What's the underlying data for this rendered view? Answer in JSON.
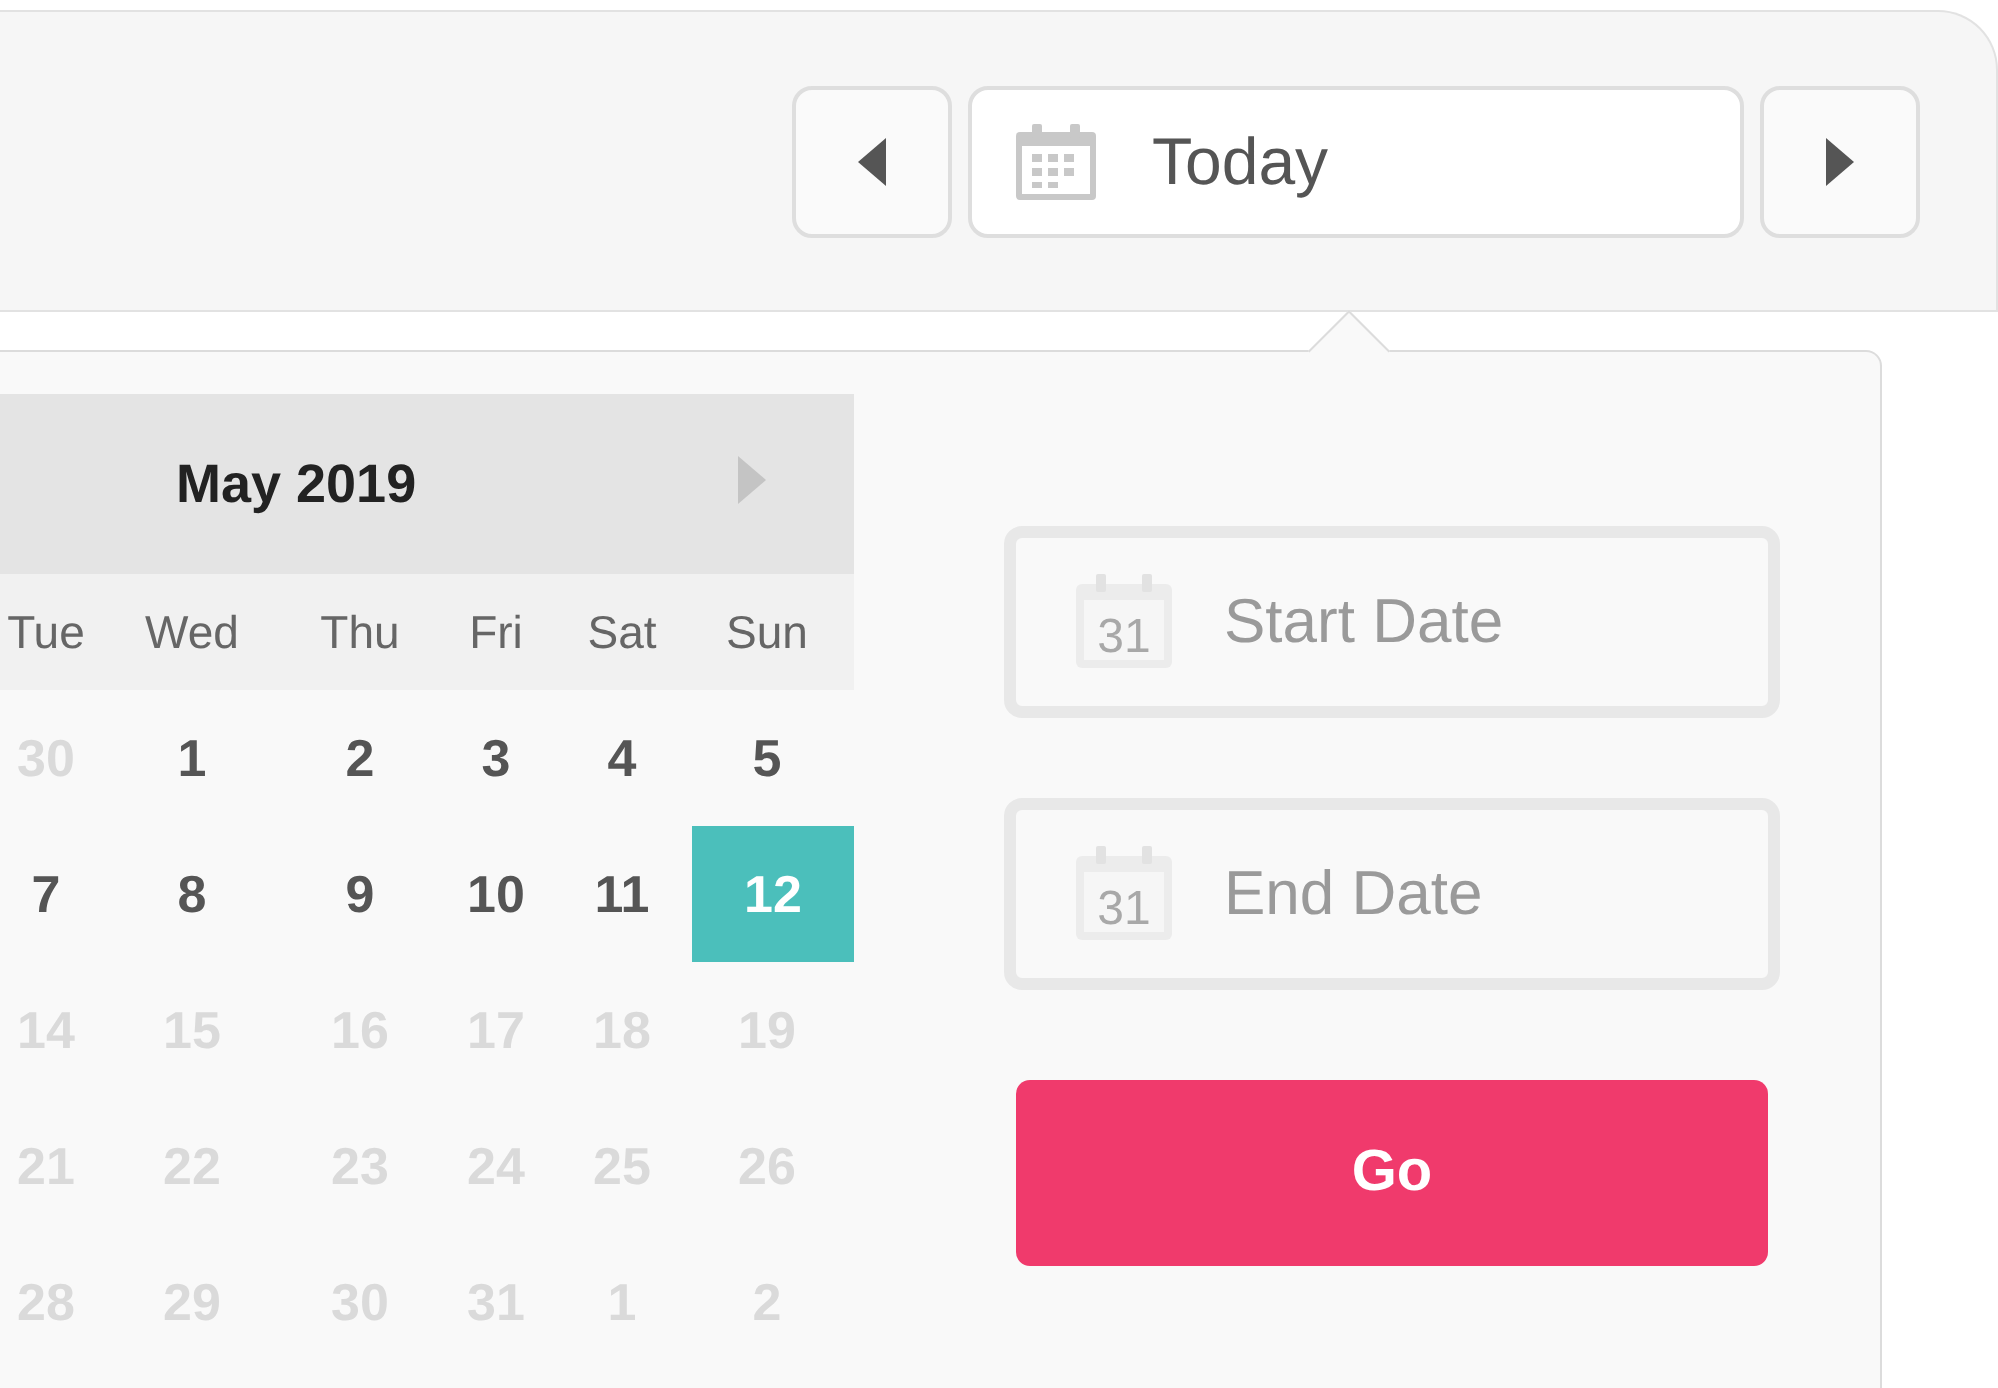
{
  "toolbar": {
    "date_button": {
      "label": "Today"
    }
  },
  "calendar": {
    "month": "May 2019",
    "weekdays": [
      "Tue",
      "Wed",
      "Thu",
      "Fri",
      "Sat",
      "Sun"
    ],
    "weeks": [
      [
        {
          "day": "30",
          "faded": true,
          "selected": false
        },
        {
          "day": "1",
          "faded": false,
          "selected": false
        },
        {
          "day": "2",
          "faded": false,
          "selected": false
        },
        {
          "day": "3",
          "faded": false,
          "selected": false
        },
        {
          "day": "4",
          "faded": false,
          "selected": false
        },
        {
          "day": "5",
          "faded": false,
          "selected": false
        }
      ],
      [
        {
          "day": "7",
          "faded": false,
          "selected": false
        },
        {
          "day": "8",
          "faded": false,
          "selected": false
        },
        {
          "day": "9",
          "faded": false,
          "selected": false
        },
        {
          "day": "10",
          "faded": false,
          "selected": false
        },
        {
          "day": "11",
          "faded": false,
          "selected": false
        },
        {
          "day": "12",
          "faded": false,
          "selected": true
        }
      ],
      [
        {
          "day": "14",
          "faded": true,
          "selected": false
        },
        {
          "day": "15",
          "faded": true,
          "selected": false
        },
        {
          "day": "16",
          "faded": true,
          "selected": false
        },
        {
          "day": "17",
          "faded": true,
          "selected": false
        },
        {
          "day": "18",
          "faded": true,
          "selected": false
        },
        {
          "day": "19",
          "faded": true,
          "selected": false
        }
      ],
      [
        {
          "day": "21",
          "faded": true,
          "selected": false
        },
        {
          "day": "22",
          "faded": true,
          "selected": false
        },
        {
          "day": "23",
          "faded": true,
          "selected": false
        },
        {
          "day": "24",
          "faded": true,
          "selected": false
        },
        {
          "day": "25",
          "faded": true,
          "selected": false
        },
        {
          "day": "26",
          "faded": true,
          "selected": false
        }
      ],
      [
        {
          "day": "28",
          "faded": true,
          "selected": false
        },
        {
          "day": "29",
          "faded": true,
          "selected": false
        },
        {
          "day": "30",
          "faded": true,
          "selected": false
        },
        {
          "day": "31",
          "faded": true,
          "selected": false
        },
        {
          "day": "1",
          "faded": true,
          "selected": false
        },
        {
          "day": "2",
          "faded": true,
          "selected": false
        }
      ]
    ]
  },
  "range": {
    "fields": [
      {
        "placeholder": "Start Date",
        "icon_day": "31"
      },
      {
        "placeholder": "End Date",
        "icon_day": "31"
      }
    ],
    "go_button": "Go"
  }
}
